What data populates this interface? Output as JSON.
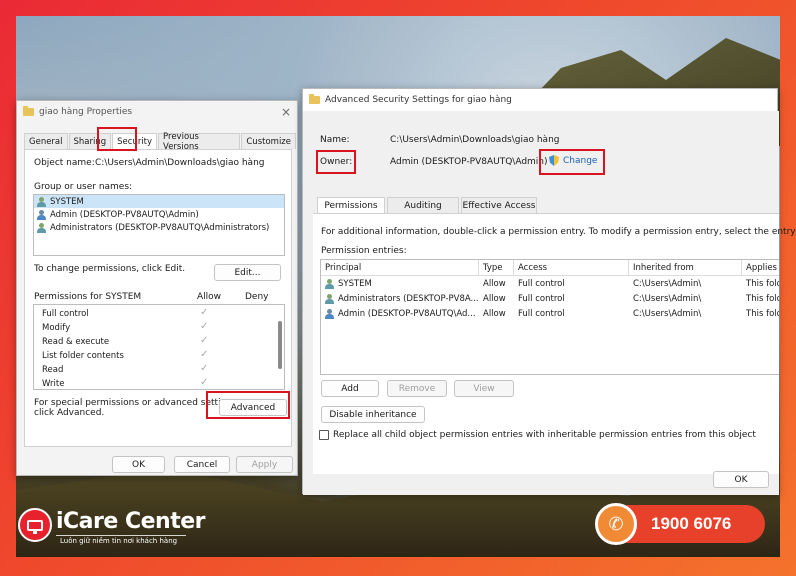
{
  "properties_dialog": {
    "title": "giao hàng Properties",
    "close_glyph": "×",
    "tabs": [
      "General",
      "Sharing",
      "Security",
      "Previous Versions",
      "Customize"
    ],
    "object_name_label": "Object name:",
    "object_name_value": "C:\\Users\\Admin\\Downloads\\giao hàng",
    "group_label": "Group or user names:",
    "users": [
      "SYSTEM",
      "Admin (DESKTOP-PV8AUTQ\\Admin)",
      "Administrators (DESKTOP-PV8AUTQ\\Administrators)"
    ],
    "change_perm_text": "To change permissions, click Edit.",
    "edit_button": "Edit...",
    "permissions_for": "Permissions for SYSTEM",
    "allow_header": "Allow",
    "deny_header": "Deny",
    "permissions": [
      "Full control",
      "Modify",
      "Read & execute",
      "List folder contents",
      "Read",
      "Write"
    ],
    "check_glyph": "✓",
    "special_text_1": "For special permissions or advanced settings,",
    "special_text_2": "click Advanced.",
    "advanced_button": "Advanced",
    "ok_button": "OK",
    "cancel_button": "Cancel",
    "apply_button": "Apply"
  },
  "advanced_dialog": {
    "title": "Advanced Security Settings for giao hàng",
    "name_label": "Name:",
    "name_value": "C:\\Users\\Admin\\Downloads\\giao hàng",
    "owner_label": "Owner:",
    "owner_value": "Admin (DESKTOP-PV8AUTQ\\Admin)",
    "change_link": "Change",
    "tabs": [
      "Permissions",
      "Auditing",
      "Effective Access"
    ],
    "info_text": "For additional information, double-click a permission entry. To modify a permission entry, select the entry and c",
    "entries_label": "Permission entries:",
    "columns": [
      "Principal",
      "Type",
      "Access",
      "Inherited from",
      "Applies"
    ],
    "entries": [
      {
        "principal": "SYSTEM",
        "type": "Allow",
        "access": "Full control",
        "inherited": "C:\\Users\\Admin\\",
        "applies": "This fold"
      },
      {
        "principal": "Administrators (DESKTOP-PV8A...",
        "type": "Allow",
        "access": "Full control",
        "inherited": "C:\\Users\\Admin\\",
        "applies": "This fold"
      },
      {
        "principal": "Admin (DESKTOP-PV8AUTQ\\Ad...",
        "type": "Allow",
        "access": "Full control",
        "inherited": "C:\\Users\\Admin\\",
        "applies": "This fold"
      }
    ],
    "add_button": "Add",
    "remove_button": "Remove",
    "view_button": "View",
    "disable_inheritance_button": "Disable inheritance",
    "replace_checkbox_label": "Replace all child object permission entries with inheritable permission entries from this object",
    "ok_button": "OK"
  },
  "branding": {
    "brand_name": "iCare Center",
    "slogan": "Luôn giữ niềm tin nơi khách hàng",
    "hotline": "1900 6076",
    "phone_glyph": "✆"
  },
  "colors": {
    "highlight_red": "#d7141f",
    "selection_blue": "#cce4f7",
    "link_blue": "#1a5fb4",
    "brand_red": "#e8222c",
    "brand_orange": "#f08a35"
  }
}
